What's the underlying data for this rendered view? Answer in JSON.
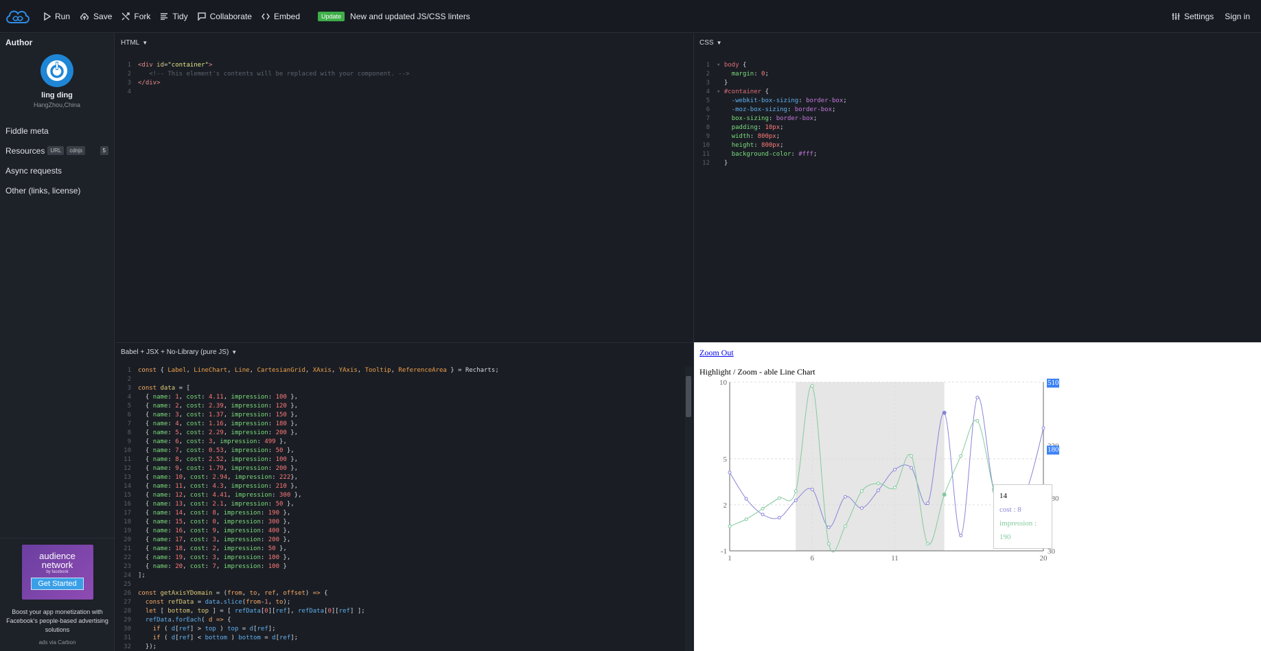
{
  "topbar": {
    "run": "Run",
    "save": "Save",
    "fork": "Fork",
    "tidy": "Tidy",
    "collaborate": "Collaborate",
    "embed": "Embed",
    "update_badge": "Update",
    "update_text": "New and updated JS/CSS linters",
    "settings": "Settings",
    "signin": "Sign in"
  },
  "sidebar": {
    "author_title": "Author",
    "author_name": "ling ding",
    "author_location": "HangZhou,China",
    "items": [
      {
        "label": "Fiddle meta"
      },
      {
        "label": "Resources",
        "tags": [
          "URL",
          "cdnjs"
        ],
        "count": "5"
      },
      {
        "label": "Async requests"
      },
      {
        "label": "Other (links, license)"
      }
    ],
    "ad": {
      "line1": "audience",
      "line2": "network",
      "line3": "by facebook",
      "button": "Get Started",
      "text": "Boost your app monetization with Facebook's people-based advertising solutions",
      "via": "ads via Carbon"
    }
  },
  "panels": {
    "html_label": "HTML",
    "css_label": "CSS",
    "js_label": "Babel + JSX + No-Library (pure JS)"
  },
  "result": {
    "zoom_out": "Zoom Out",
    "title": "Highlight / Zoom - able Line Chart",
    "tooltip": {
      "name": "14",
      "cost": "cost : 8",
      "impression": "impression : 190"
    }
  },
  "chart_data": {
    "type": "line",
    "x": [
      1,
      2,
      3,
      4,
      5,
      6,
      7,
      8,
      9,
      10,
      11,
      12,
      13,
      14,
      15,
      16,
      17,
      18,
      19,
      20
    ],
    "series": [
      {
        "name": "cost",
        "color": "#8884d8",
        "axis": "left",
        "values": [
          4.11,
          2.39,
          1.37,
          1.16,
          2.29,
          3,
          0.53,
          2.52,
          1.79,
          2.94,
          4.3,
          4.41,
          2.1,
          8,
          0,
          9,
          3,
          2,
          3,
          7
        ]
      },
      {
        "name": "impression",
        "color": "#82ca9d",
        "axis": "right",
        "values": [
          100,
          120,
          150,
          180,
          200,
          499,
          50,
          100,
          200,
          222,
          210,
          300,
          50,
          190,
          300,
          400,
          200,
          50,
          100,
          100
        ]
      }
    ],
    "x_ticks": [
      "1",
      "6",
      "11",
      "20"
    ],
    "y_left_ticks": [
      "10",
      "5",
      "2",
      "-1"
    ],
    "y_right_ticks": [
      "330",
      "180",
      "30"
    ],
    "y_right_ticks_highlighted": [
      "510",
      "180"
    ],
    "reference_area": {
      "x1": 5,
      "x2": 14
    },
    "active_x": 14
  }
}
